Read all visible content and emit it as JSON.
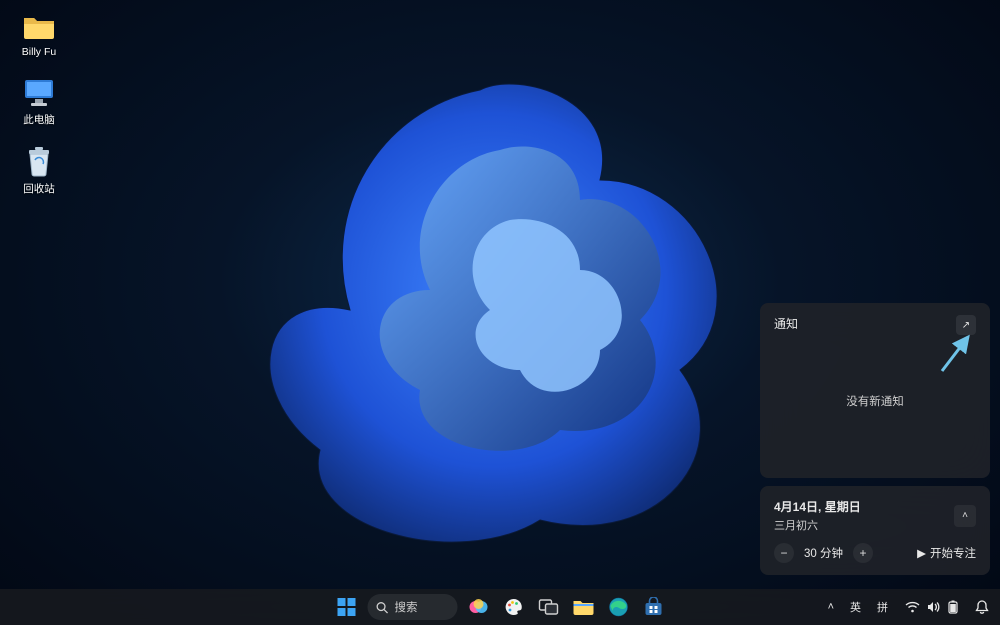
{
  "desktop": {
    "icons": [
      {
        "id": "user-folder",
        "label": "Billy Fu"
      },
      {
        "id": "this-pc",
        "label": "此电脑"
      },
      {
        "id": "recycle-bin",
        "label": "回收站"
      }
    ]
  },
  "notification_panel": {
    "title": "通知",
    "empty_text": "没有新通知",
    "expand_glyph": "↗"
  },
  "calendar_panel": {
    "date_line": "4月14日, 星期日",
    "lunar_line": "三月初六",
    "chevron_glyph": "˄",
    "focus": {
      "minus": "−",
      "plus": "+",
      "value": "30 分钟",
      "start_label": "开始专注",
      "play_glyph": "▶"
    }
  },
  "taskbar": {
    "search_placeholder": "搜索",
    "ime": {
      "lang": "英",
      "mode": "拼"
    },
    "tray": {
      "chevron_glyph": "˄"
    }
  }
}
